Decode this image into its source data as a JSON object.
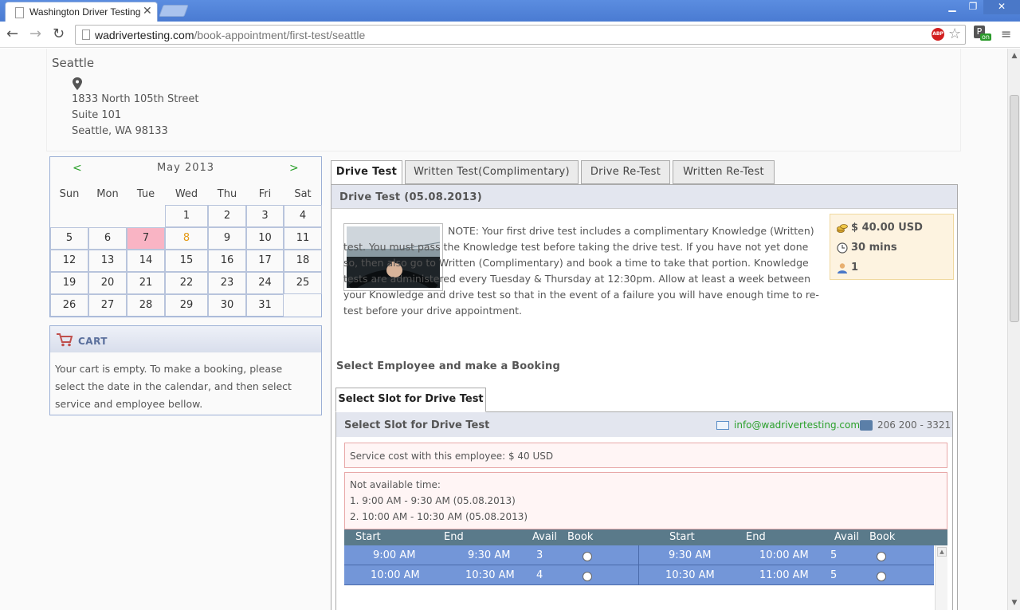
{
  "browser": {
    "tab_title": "Washington Driver Testing",
    "tab_close": "✕",
    "url_host": "wadrivertesting.com",
    "url_path": "/book-appointment/first-test/seattle",
    "ext_on_label": "on",
    "ext_p_label": "P",
    "abp_label": "ABP"
  },
  "location": {
    "title": "Seattle",
    "address_line1": "1833 North 105th Street",
    "address_line2": "Suite 101",
    "address_line3": "Seattle, WA 98133"
  },
  "calendar": {
    "prev": "<",
    "next": ">",
    "month": "May   2013",
    "weekdays": [
      "Sun",
      "Mon",
      "Tue",
      "Wed",
      "Thu",
      "Fri",
      "Sat"
    ],
    "today": 7,
    "highlight": 8
  },
  "cart": {
    "title": "CART",
    "text": "Your cart is empty. To make a booking, please select the date in the calendar, and then select service and employee bellow."
  },
  "tabs": [
    "Drive Test",
    "Written Test(Complimentary)",
    "Drive Re-Test",
    "Written Re-Test"
  ],
  "panel": {
    "title": "Drive Test (05.08.2013)",
    "note": "NOTE: Your first drive test includes a complimentary Knowledge (Written) test. You must pass the Knowledge test before taking the drive test. If you have not yet done so, then also go to Written (Complimentary) and book a time to take that portion. Knowledge tests are administered every Tuesday & Thursday at 12:30pm. Allow at least a week between your Knowledge and drive test so that in the event of a failure you will have enough time to re-test before your drive appointment.",
    "price": "$ 40.00 USD",
    "duration": "30 mins",
    "capacity": "1"
  },
  "booking": {
    "select_employee": "Select Employee and make a Booking",
    "slot_tab": "Select Slot for Drive Test",
    "slot_title": "Select Slot for Drive Test",
    "email": "info@wadrivertesting.com",
    "phone": "206 200 - 3321",
    "cost": "Service cost with this employee: $ 40 USD",
    "not_available_title": "Not available time:",
    "not_available": [
      "1. 9:00 AM - 9:30 AM (05.08.2013)",
      "2. 10:00 AM - 10:30 AM (05.08.2013)"
    ],
    "headers": [
      "Start",
      "End",
      "Avail",
      "Book",
      "Start",
      "End",
      "Avail",
      "Book"
    ],
    "rows": [
      {
        "start1": "9:00 AM",
        "end1": "9:30 AM",
        "avail1": "3",
        "start2": "9:30 AM",
        "end2": "10:00 AM",
        "avail2": "5"
      },
      {
        "start1": "10:00 AM",
        "end1": "10:30 AM",
        "avail1": "4",
        "start2": "10:30 AM",
        "end2": "11:00 AM",
        "avail2": "5"
      }
    ]
  }
}
